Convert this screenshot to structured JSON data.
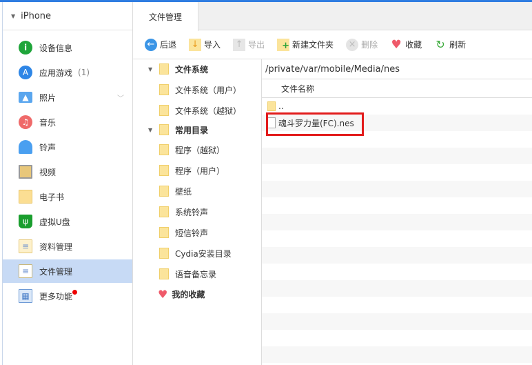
{
  "device": "iPhone",
  "sidebar": {
    "items": [
      {
        "label": "设备信息",
        "icon": "info-icon"
      },
      {
        "label": "应用游戏",
        "count": "(1)",
        "icon": "app-store-icon"
      },
      {
        "label": "照片",
        "icon": "photo-icon"
      },
      {
        "label": "音乐",
        "icon": "music-icon"
      },
      {
        "label": "铃声",
        "icon": "bell-icon"
      },
      {
        "label": "视频",
        "icon": "film-icon"
      },
      {
        "label": "电子书",
        "icon": "book-icon"
      },
      {
        "label": "虚拟U盘",
        "icon": "usb-icon"
      },
      {
        "label": "资料管理",
        "icon": "contacts-icon"
      },
      {
        "label": "文件管理",
        "icon": "file-icon",
        "selected": true
      },
      {
        "label": "更多功能",
        "icon": "more-icon"
      }
    ]
  },
  "tab": "文件管理",
  "toolbar": {
    "back": "后退",
    "import": "导入",
    "export": "导出",
    "new_folder": "新建文件夹",
    "delete": "删除",
    "favorite": "收藏",
    "refresh": "刷新"
  },
  "tree": {
    "filesystem": "文件系统",
    "fs_user": "文件系统（用户）",
    "fs_jb": "文件系统（越狱）",
    "common": "常用目录",
    "items": [
      "程序（越狱）",
      "程序（用户）",
      "壁纸",
      "系统铃声",
      "短信铃声",
      "Cydia安装目录",
      "语音备忘录"
    ],
    "favorites": "我的收藏"
  },
  "list": {
    "path": "/private/var/mobile/Media/nes",
    "header": "文件名称",
    "rows": [
      "..",
      "魂斗罗力量(FC).nes"
    ]
  },
  "colors": {
    "accent": "#2f7de1",
    "selected": "#c7daf5",
    "highlight": "#e21b1b"
  }
}
